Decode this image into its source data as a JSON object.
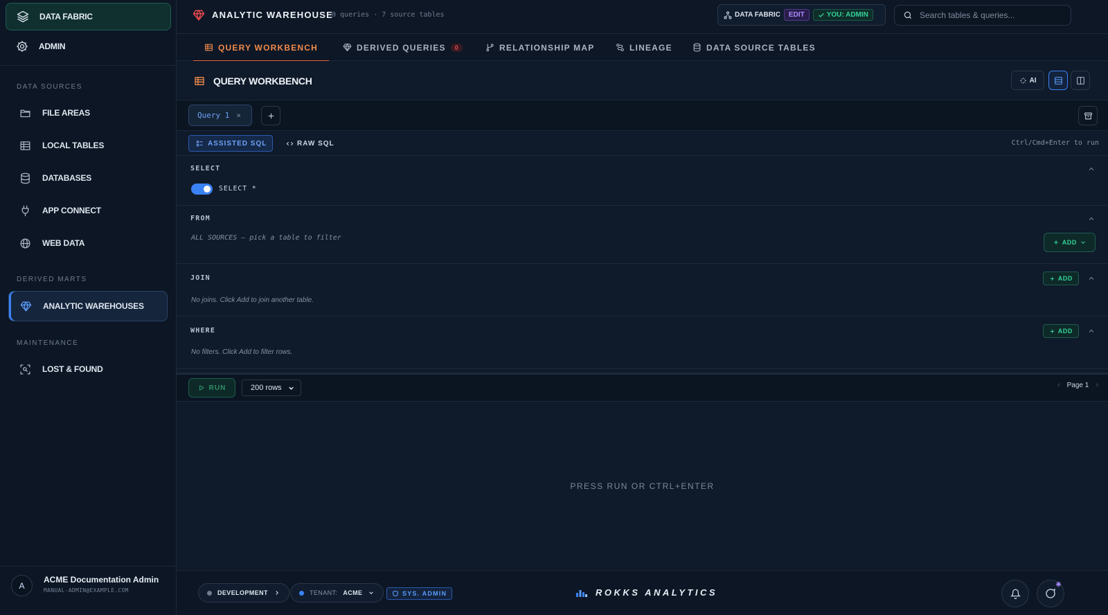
{
  "sidebar": {
    "top_items": [
      {
        "label": "DATA FABRIC",
        "icon": "layers-icon"
      },
      {
        "label": "ADMIN",
        "icon": "gear-icon"
      }
    ],
    "sections": [
      {
        "title": "DATA SOURCES"
      },
      {
        "title": "DERIVED MARTS"
      },
      {
        "title": "MAINTENANCE"
      }
    ],
    "items": [
      {
        "label": "FILE AREAS",
        "icon": "folder-icon"
      },
      {
        "label": "LOCAL TABLES",
        "icon": "table-icon"
      },
      {
        "label": "DATABASES",
        "icon": "database-icon"
      },
      {
        "label": "APP CONNECT",
        "icon": "plug-icon"
      },
      {
        "label": "WEB DATA",
        "icon": "globe-icon"
      },
      {
        "label": "ANALYTIC WAREHOUSES",
        "icon": "gem-icon"
      },
      {
        "label": "LOST & FOUND",
        "icon": "scan-search-icon"
      }
    ],
    "user": {
      "initial": "A",
      "name": "ACME Documentation Admin",
      "email": "MANUAL-ADMIN@EXAMPLE.COM"
    }
  },
  "topbar": {
    "title": "ANALYTIC WAREHOUSE",
    "subtitle": "0 queries · 7 source tables",
    "fabric_label": "DATA FABRIC",
    "edit_badge": "EDIT",
    "role_badge": "YOU: ADMIN",
    "search_placeholder": "Search tables & queries..."
  },
  "tabs": [
    {
      "label": "QUERY WORKBENCH",
      "icon": "table-icon"
    },
    {
      "label": "DERIVED QUERIES",
      "icon": "gem-icon",
      "count": "0"
    },
    {
      "label": "RELATIONSHIP MAP",
      "icon": "git-branch-icon"
    },
    {
      "label": "LINEAGE",
      "icon": "route-icon"
    },
    {
      "label": "DATA SOURCE TABLES",
      "icon": "database-icon"
    }
  ],
  "workbench": {
    "title": "QUERY WORKBENCH",
    "ai_label": "AI",
    "query_tab": "Query 1",
    "close_glyph": "×",
    "modes": {
      "assisted": "ASSISTED SQL",
      "raw": "RAW SQL"
    },
    "run_hint": "Ctrl/Cmd+Enter to run",
    "select": {
      "title": "SELECT",
      "toggle_label": "SELECT *"
    },
    "from": {
      "title": "FROM",
      "hint": "ALL SOURCES — pick a table to filter",
      "add": "ADD"
    },
    "join": {
      "title": "JOIN",
      "hint": "No joins. Click Add to join another table.",
      "add": "ADD"
    },
    "where": {
      "title": "WHERE",
      "hint": "No filters. Click Add to filter rows.",
      "add": "ADD"
    },
    "run_label": "RUN",
    "rows_option": "200 rows",
    "page_label": "Page 1",
    "empty_results": "PRESS RUN OR CTRL+ENTER"
  },
  "footer": {
    "environment": "DEVELOPMENT",
    "tenant_key": "TENANT:",
    "tenant_value": "ACME",
    "role": "SYS. ADMIN",
    "brand": "ROKKS ANALYTICS"
  },
  "colors": {
    "accent_orange": "#e8613a",
    "accent_blue": "#3b82f6",
    "accent_green": "#34d399",
    "accent_purple": "#a78bfa",
    "danger_red": "#e5484d"
  }
}
